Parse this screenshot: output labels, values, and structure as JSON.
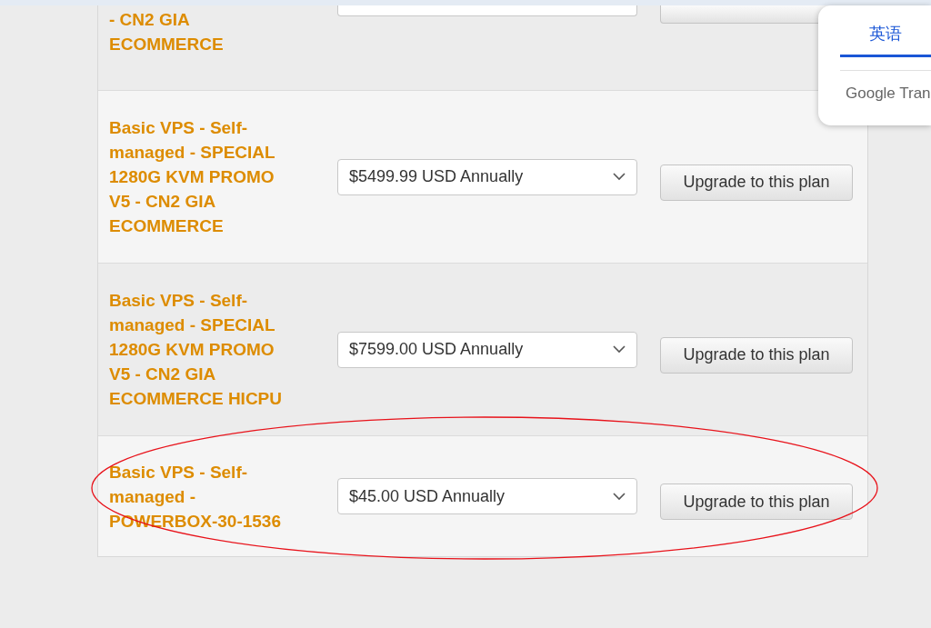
{
  "plans": [
    {
      "kind": "partial",
      "name": "- CN2 GIA ECOMMERCE",
      "circled": false
    },
    {
      "kind": "full",
      "name": "Basic VPS - Self-managed - SPECIAL 1280G KVM PROMO V5 - CN2 GIA ECOMMERCE",
      "price": "$5499.99 USD Annually",
      "button": "Upgrade to this plan",
      "circled": false
    },
    {
      "kind": "full",
      "name": "Basic VPS - Self-managed - SPECIAL 1280G KVM PROMO V5 - CN2 GIA ECOMMERCE HICPU",
      "price": "$7599.00 USD Annually",
      "button": "Upgrade to this plan",
      "circled": false
    },
    {
      "kind": "full",
      "name": "Basic VPS - Self-managed - POWERBOX-30-1536",
      "price": "$45.00 USD Annually",
      "button": "Upgrade to this plan",
      "circled": true
    }
  ],
  "translate_popup": {
    "tabs": [
      {
        "label": "英语",
        "selected": true
      }
    ],
    "brand": "Google Tran"
  }
}
